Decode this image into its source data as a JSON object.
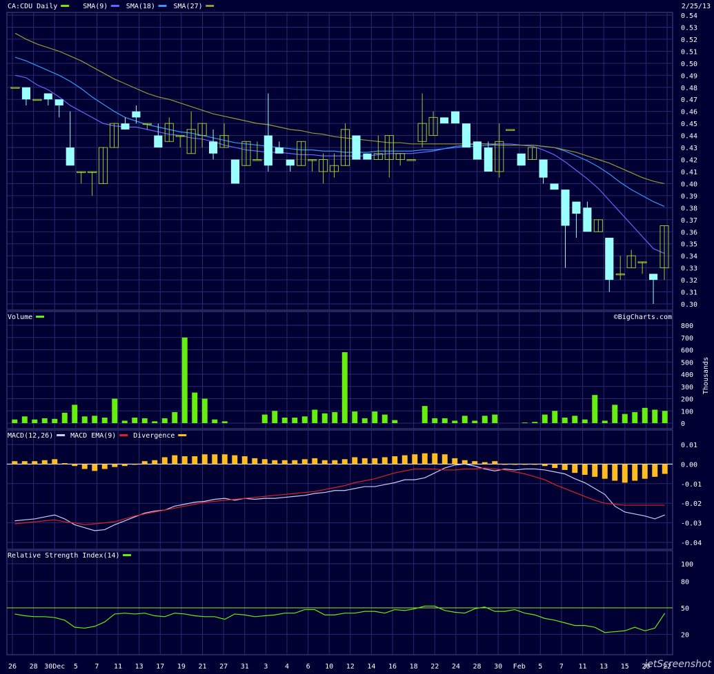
{
  "header": {
    "symbol_label": "CA:CDU Daily",
    "date": "2/25/13",
    "copyright": "©BigCharts.com"
  },
  "colors": {
    "background": "#000033",
    "grid": "#2b2b6e",
    "up_candle": "#99cc33",
    "down_candle": "#99ffff",
    "sma9": "#6666ff",
    "sma18": "#3399ff",
    "sma27": "#999933",
    "volume": "#66ee11",
    "macd": "#ccccff",
    "macd_ema": "#dd2222",
    "divergence": "#ffbb22",
    "rsi": "#66ee11",
    "rsi_ref": "#99ee22"
  },
  "legends": {
    "price": [
      {
        "label": "CA:CDU Daily",
        "color": "#66ee11"
      },
      {
        "label": "SMA(9)",
        "color": "#6666ff"
      },
      {
        "label": "SMA(18)",
        "color": "#3399ff"
      },
      {
        "label": "SMA(27)",
        "color": "#999933"
      }
    ],
    "volume": [
      {
        "label": "Volume",
        "color": "#66ee11"
      }
    ],
    "macd": [
      {
        "label": "MACD(12,26)",
        "color": "#ccccff"
      },
      {
        "label": "MACD EMA(9)",
        "color": "#dd2222"
      },
      {
        "label": "Divergence",
        "color": "#ffbb22"
      }
    ],
    "rsi": [
      {
        "label": "Relative Strength Index(14)",
        "color": "#66ee11"
      }
    ]
  },
  "x_labels": [
    "26",
    "28",
    "30Dec",
    "5",
    "7",
    "11",
    "13",
    "17",
    "19",
    "21",
    "27",
    "31",
    "3",
    "4",
    "6",
    "10",
    "12",
    "14",
    "16",
    "18",
    "22",
    "24",
    "28",
    "30",
    "Feb",
    "5",
    "7",
    "11",
    "13",
    "15",
    "20",
    "22"
  ],
  "watermark": "jetScreenshot",
  "chart_data": [
    {
      "type": "candlestick",
      "title": "CA:CDU Daily",
      "ylim": [
        0.3,
        0.54
      ],
      "y_ticks": [
        "0.54",
        "0.53",
        "0.52",
        "0.51",
        "0.50",
        "0.49",
        "0.48",
        "0.47",
        "0.46",
        "0.45",
        "0.44",
        "0.43",
        "0.42",
        "0.41",
        "0.40",
        "0.39",
        "0.38",
        "0.37",
        "0.36",
        "0.35",
        "0.34",
        "0.33",
        "0.32",
        "0.31",
        "0.30"
      ],
      "candles": [
        [
          0.48,
          0.48,
          0.48,
          0.48
        ],
        [
          0.48,
          0.48,
          0.465,
          0.47
        ],
        [
          0.47,
          0.47,
          0.47,
          0.47
        ],
        [
          0.475,
          0.475,
          0.465,
          0.47
        ],
        [
          0.47,
          0.47,
          0.455,
          0.465
        ],
        [
          0.43,
          0.46,
          0.415,
          0.415
        ],
        [
          0.41,
          0.41,
          0.4,
          0.41
        ],
        [
          0.41,
          0.41,
          0.39,
          0.41
        ],
        [
          0.4,
          0.43,
          0.4,
          0.43
        ],
        [
          0.43,
          0.45,
          0.43,
          0.45
        ],
        [
          0.45,
          0.455,
          0.445,
          0.445
        ],
        [
          0.46,
          0.465,
          0.45,
          0.455
        ],
        [
          0.45,
          0.45,
          0.445,
          0.45
        ],
        [
          0.44,
          0.45,
          0.43,
          0.43
        ],
        [
          0.435,
          0.455,
          0.435,
          0.45
        ],
        [
          0.44,
          0.44,
          0.43,
          0.44
        ],
        [
          0.425,
          0.46,
          0.425,
          0.445
        ],
        [
          0.44,
          0.45,
          0.43,
          0.45
        ],
        [
          0.435,
          0.445,
          0.42,
          0.425
        ],
        [
          0.43,
          0.45,
          0.43,
          0.44
        ],
        [
          0.42,
          0.42,
          0.4,
          0.4
        ],
        [
          0.415,
          0.435,
          0.415,
          0.435
        ],
        [
          0.42,
          0.435,
          0.42,
          0.42
        ],
        [
          0.44,
          0.475,
          0.41,
          0.415
        ],
        [
          0.43,
          0.435,
          0.425,
          0.425
        ],
        [
          0.42,
          0.42,
          0.41,
          0.415
        ],
        [
          0.415,
          0.435,
          0.415,
          0.435
        ],
        [
          0.42,
          0.42,
          0.41,
          0.42
        ],
        [
          0.41,
          0.425,
          0.4,
          0.42
        ],
        [
          0.41,
          0.425,
          0.405,
          0.415
        ],
        [
          0.415,
          0.45,
          0.415,
          0.445
        ],
        [
          0.44,
          0.44,
          0.42,
          0.42
        ],
        [
          0.425,
          0.425,
          0.42,
          0.42
        ],
        [
          0.42,
          0.44,
          0.42,
          0.425
        ],
        [
          0.42,
          0.44,
          0.405,
          0.44
        ],
        [
          0.42,
          0.425,
          0.415,
          0.425
        ],
        [
          0.42,
          0.42,
          0.42,
          0.42
        ],
        [
          0.435,
          0.475,
          0.43,
          0.45
        ],
        [
          0.44,
          0.46,
          0.44,
          0.455
        ],
        [
          0.455,
          0.455,
          0.45,
          0.45
        ],
        [
          0.46,
          0.46,
          0.45,
          0.45
        ],
        [
          0.45,
          0.45,
          0.43,
          0.43
        ],
        [
          0.435,
          0.435,
          0.42,
          0.42
        ],
        [
          0.43,
          0.435,
          0.41,
          0.41
        ],
        [
          0.41,
          0.45,
          0.405,
          0.435
        ],
        [
          0.445,
          0.445,
          0.445,
          0.445
        ],
        [
          0.425,
          0.425,
          0.415,
          0.415
        ],
        [
          0.42,
          0.43,
          0.42,
          0.43
        ],
        [
          0.42,
          0.42,
          0.4,
          0.405
        ],
        [
          0.4,
          0.4,
          0.395,
          0.395
        ],
        [
          0.395,
          0.395,
          0.33,
          0.365
        ],
        [
          0.385,
          0.385,
          0.355,
          0.375
        ],
        [
          0.38,
          0.385,
          0.36,
          0.36
        ],
        [
          0.36,
          0.37,
          0.36,
          0.37
        ],
        [
          0.355,
          0.355,
          0.31,
          0.32
        ],
        [
          0.325,
          0.34,
          0.32,
          0.325
        ],
        [
          0.33,
          0.345,
          0.33,
          0.34
        ],
        [
          0.335,
          0.335,
          0.325,
          0.335
        ],
        [
          0.325,
          0.325,
          0.3,
          0.32
        ],
        [
          0.33,
          0.365,
          0.32,
          0.365
        ]
      ],
      "series": [
        {
          "name": "SMA(9)",
          "values": [
            0.49,
            0.488,
            0.482,
            0.478,
            0.472,
            0.465,
            0.46,
            0.455,
            0.45,
            0.448,
            0.447,
            0.447,
            0.445,
            0.443,
            0.441,
            0.44,
            0.438,
            0.437,
            0.435,
            0.432,
            0.43,
            0.428,
            0.427,
            0.426,
            0.426,
            0.425,
            0.424,
            0.424,
            0.423,
            0.423,
            0.423,
            0.423,
            0.423,
            0.424,
            0.425,
            0.425,
            0.425,
            0.426,
            0.427,
            0.429,
            0.431,
            0.432,
            0.433,
            0.433,
            0.433,
            0.433,
            0.432,
            0.431,
            0.428,
            0.424,
            0.418,
            0.411,
            0.404,
            0.396,
            0.386,
            0.376,
            0.366,
            0.356,
            0.346,
            0.342
          ]
        },
        {
          "name": "SMA(18)",
          "values": [
            0.505,
            0.502,
            0.498,
            0.494,
            0.49,
            0.485,
            0.479,
            0.472,
            0.466,
            0.46,
            0.455,
            0.452,
            0.449,
            0.447,
            0.445,
            0.443,
            0.442,
            0.44,
            0.438,
            0.436,
            0.434,
            0.433,
            0.432,
            0.431,
            0.43,
            0.429,
            0.428,
            0.428,
            0.427,
            0.427,
            0.426,
            0.426,
            0.426,
            0.427,
            0.427,
            0.427,
            0.427,
            0.428,
            0.428,
            0.429,
            0.43,
            0.431,
            0.431,
            0.432,
            0.432,
            0.432,
            0.432,
            0.432,
            0.431,
            0.43,
            0.427,
            0.423,
            0.419,
            0.414,
            0.408,
            0.401,
            0.395,
            0.39,
            0.385,
            0.381
          ]
        },
        {
          "name": "SMA(27)",
          "values": [
            0.525,
            0.52,
            0.516,
            0.513,
            0.51,
            0.506,
            0.502,
            0.497,
            0.492,
            0.487,
            0.483,
            0.479,
            0.475,
            0.472,
            0.47,
            0.467,
            0.464,
            0.461,
            0.458,
            0.456,
            0.454,
            0.452,
            0.45,
            0.449,
            0.447,
            0.445,
            0.444,
            0.442,
            0.441,
            0.439,
            0.438,
            0.437,
            0.436,
            0.435,
            0.434,
            0.434,
            0.433,
            0.433,
            0.433,
            0.433,
            0.433,
            0.433,
            0.433,
            0.433,
            0.432,
            0.432,
            0.432,
            0.432,
            0.431,
            0.43,
            0.428,
            0.426,
            0.423,
            0.42,
            0.417,
            0.413,
            0.409,
            0.405,
            0.402,
            0.4
          ]
        }
      ]
    },
    {
      "type": "bar",
      "title": "Volume",
      "ylabel": "Thousands",
      "ylim": [
        0,
        800
      ],
      "y_ticks": [
        "800",
        "700",
        "600",
        "500",
        "400",
        "300",
        "200",
        "100",
        "0"
      ],
      "values": [
        30,
        55,
        30,
        40,
        35,
        85,
        150,
        55,
        60,
        45,
        200,
        20,
        45,
        40,
        15,
        40,
        90,
        700,
        250,
        200,
        30,
        15,
        0,
        0,
        0,
        70,
        100,
        45,
        45,
        55,
        110,
        80,
        90,
        580,
        95,
        40,
        95,
        70,
        25,
        0,
        0,
        140,
        40,
        40,
        20,
        60,
        20,
        60,
        70,
        0,
        0,
        5,
        10,
        70,
        100,
        45,
        60,
        30,
        230,
        20,
        150,
        75,
        90,
        125,
        110,
        100
      ]
    },
    {
      "type": "line",
      "title": "MACD(12,26)",
      "ylim": [
        -0.04,
        0.01
      ],
      "y_ticks": [
        "0.01",
        "0.00",
        "-0.01",
        "-0.02",
        "-0.03",
        "-0.04"
      ],
      "series": [
        {
          "name": "MACD(12,26)",
          "values": [
            -0.029,
            -0.0285,
            -0.028,
            -0.027,
            -0.026,
            -0.028,
            -0.031,
            -0.0325,
            -0.034,
            -0.0335,
            -0.031,
            -0.029,
            -0.027,
            -0.025,
            -0.024,
            -0.0235,
            -0.0215,
            -0.0205,
            -0.0195,
            -0.019,
            -0.018,
            -0.0175,
            -0.0185,
            -0.0175,
            -0.018,
            -0.0175,
            -0.0175,
            -0.017,
            -0.0165,
            -0.016,
            -0.015,
            -0.0145,
            -0.0135,
            -0.0135,
            -0.0125,
            -0.0115,
            -0.0115,
            -0.0105,
            -0.0095,
            -0.008,
            -0.008,
            -0.007,
            -0.0045,
            -0.002,
            -0.0005,
            0.0,
            -0.001,
            -0.0025,
            -0.0035,
            -0.0025,
            -0.003,
            -0.0025,
            -0.0025,
            -0.003,
            -0.004,
            -0.005,
            -0.0075,
            -0.0095,
            -0.0125,
            -0.0155,
            -0.0215,
            -0.0245,
            -0.0255,
            -0.0265,
            -0.028,
            -0.026
          ]
        },
        {
          "name": "MACD EMA(9)",
          "values": [
            -0.0305,
            -0.03,
            -0.0295,
            -0.029,
            -0.0285,
            -0.0295,
            -0.03,
            -0.031,
            -0.0305,
            -0.03,
            -0.0295,
            -0.028,
            -0.0265,
            -0.0255,
            -0.0245,
            -0.0235,
            -0.0225,
            -0.0215,
            -0.0205,
            -0.0195,
            -0.019,
            -0.0185,
            -0.018,
            -0.0175,
            -0.017,
            -0.0165,
            -0.016,
            -0.0155,
            -0.015,
            -0.0145,
            -0.014,
            -0.013,
            -0.012,
            -0.011,
            -0.0095,
            -0.0085,
            -0.0075,
            -0.006,
            -0.0045,
            -0.0035,
            -0.0025,
            -0.0025,
            -0.0025,
            -0.003,
            -0.003,
            -0.0025,
            -0.0025,
            -0.002,
            -0.0025,
            -0.003,
            -0.004,
            -0.005,
            -0.0065,
            -0.008,
            -0.0105,
            -0.0125,
            -0.0145,
            -0.0165,
            -0.0185,
            -0.02,
            -0.0205,
            -0.021,
            -0.021,
            -0.021,
            -0.021,
            -0.021
          ]
        },
        {
          "name": "Divergence",
          "values": [
            0.0015,
            0.0015,
            0.0015,
            0.002,
            0.0025,
            0.0005,
            -0.001,
            -0.0025,
            -0.0035,
            -0.0025,
            -0.0015,
            -0.001,
            0.0,
            0.0015,
            0.002,
            0.0035,
            0.0045,
            0.004,
            0.004,
            0.005,
            0.005,
            0.005,
            0.0045,
            0.004,
            0.003,
            0.0025,
            0.002,
            0.002,
            0.002,
            0.0025,
            0.003,
            0.002,
            0.002,
            0.0025,
            0.0035,
            0.003,
            0.003,
            0.0035,
            0.004,
            0.0045,
            0.005,
            0.0055,
            0.0055,
            0.005,
            0.003,
            0.002,
            0.0015,
            0.001,
            0.0015,
            0.0,
            0.0,
            0.0,
            0.0,
            -0.001,
            -0.002,
            -0.003,
            -0.0045,
            -0.0055,
            -0.0065,
            -0.0075,
            -0.0085,
            -0.0095,
            -0.0085,
            -0.0075,
            -0.0065,
            -0.005
          ]
        }
      ]
    },
    {
      "type": "line",
      "title": "Relative Strength Index(14)",
      "ylim": [
        0,
        100
      ],
      "y_ticks": [
        "100",
        "80",
        "50",
        "20"
      ],
      "reference": 50,
      "series": [
        {
          "name": "Relative Strength Index(14)",
          "values": [
            43,
            41,
            40,
            40,
            39,
            36,
            28,
            27,
            29,
            34,
            43,
            44,
            43,
            44,
            41,
            40,
            44,
            43,
            41,
            40,
            40,
            37,
            43,
            42,
            40,
            41,
            42,
            44,
            44,
            48,
            48,
            42,
            42,
            44,
            44,
            46,
            46,
            44,
            48,
            47,
            49,
            52,
            52,
            47,
            45,
            44,
            49,
            51,
            46,
            46,
            48,
            44,
            42,
            38,
            36,
            33,
            30,
            30,
            28,
            22,
            23,
            24,
            28,
            24,
            27,
            44
          ]
        }
      ]
    }
  ]
}
